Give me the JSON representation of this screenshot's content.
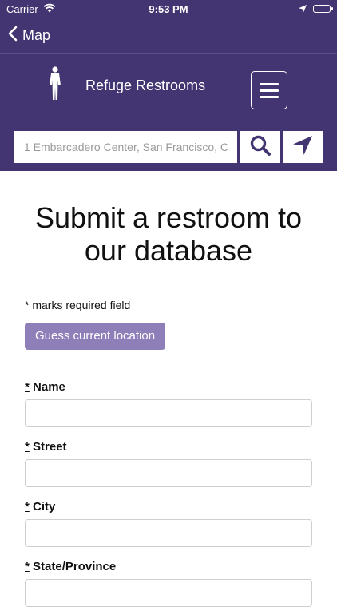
{
  "status": {
    "carrier": "Carrier",
    "time": "9:53 PM"
  },
  "nav": {
    "back_label": "Map"
  },
  "header": {
    "title": "Refuge Restrooms"
  },
  "search": {
    "placeholder": "1 Embarcadero Center, San Francisco, C"
  },
  "main": {
    "heading": "Submit a restroom to our database",
    "required_note": "* marks required field",
    "guess_button": "Guess current location",
    "fields": [
      {
        "star": "*",
        "label": "Name"
      },
      {
        "star": "*",
        "label": "Street"
      },
      {
        "star": "*",
        "label": "City"
      },
      {
        "star": "*",
        "label": "State/Province"
      }
    ]
  },
  "colors": {
    "brand": "#433572",
    "button": "#8e7fb8"
  },
  "icons": [
    "wifi-icon",
    "location-arrow-icon",
    "battery-icon",
    "chevron-left-icon",
    "person-icon",
    "menu-icon",
    "search-icon",
    "navigation-icon"
  ]
}
